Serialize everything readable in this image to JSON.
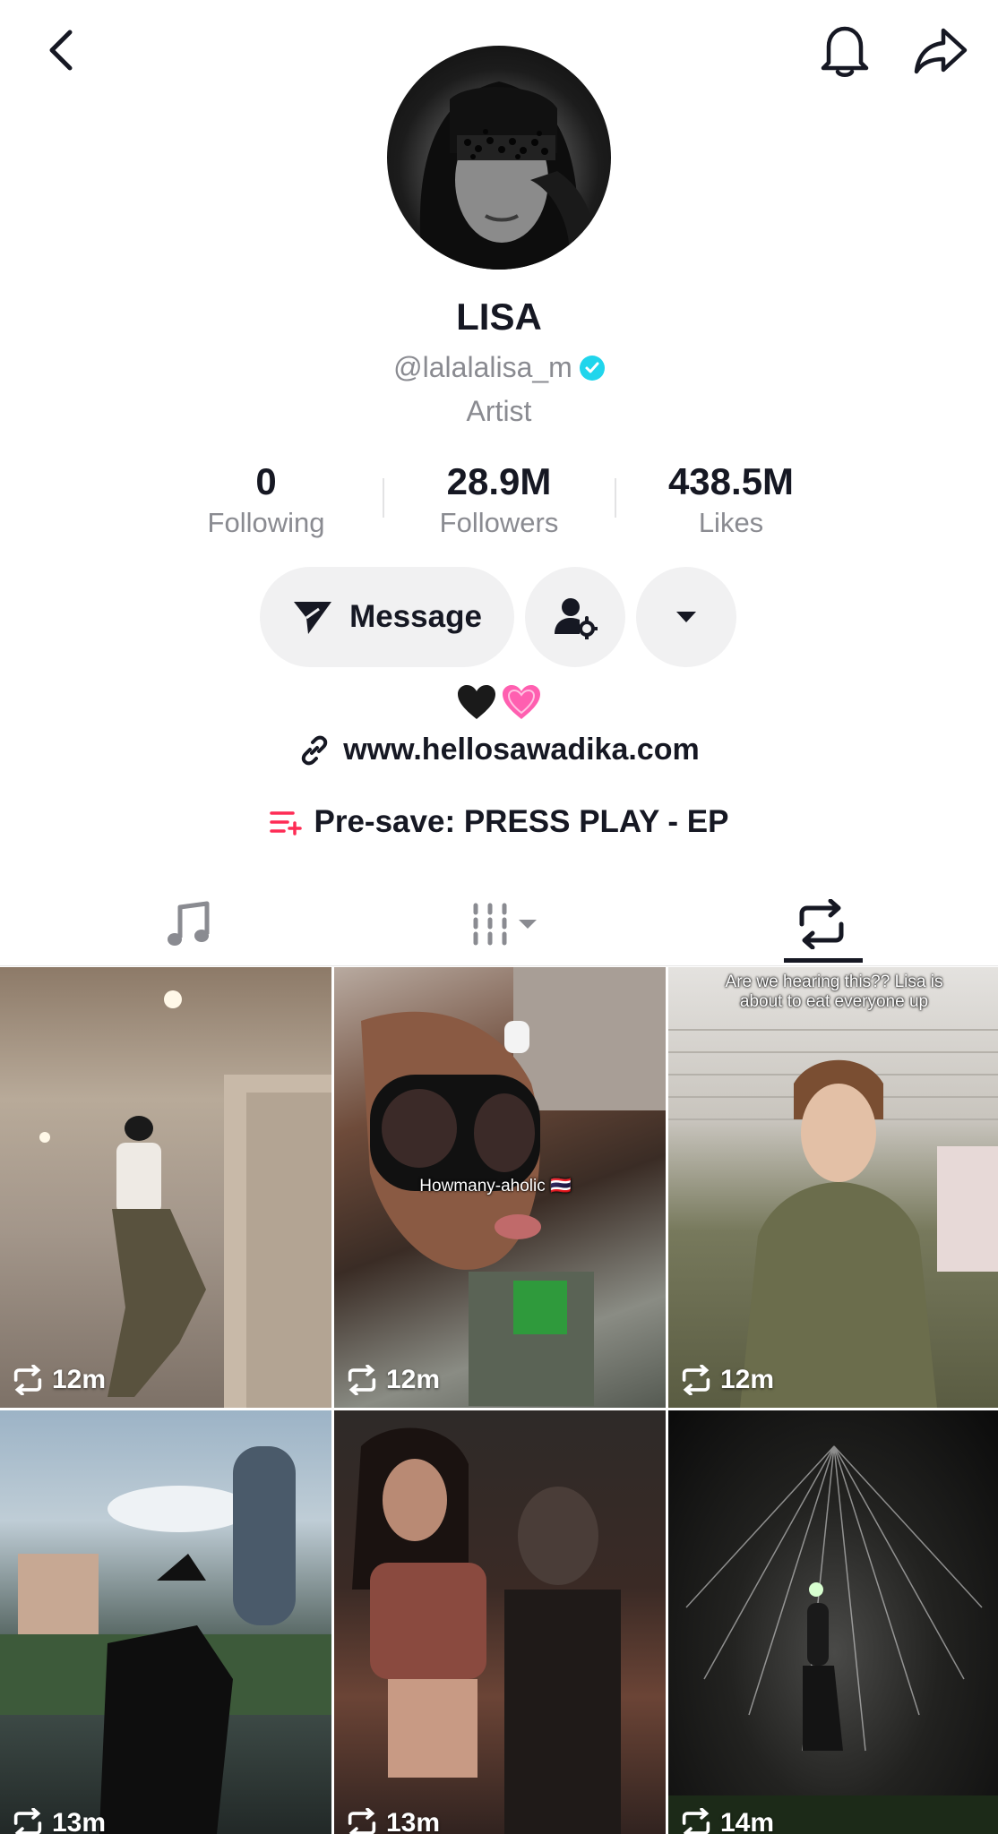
{
  "profile": {
    "name": "LISA",
    "handle": "@lalalalisa_m",
    "category": "Artist",
    "bio_emoji": "🖤💗",
    "link": "www.hellosawadika.com",
    "presave": "Pre-save: PRESS PLAY - EP"
  },
  "stats": {
    "following": {
      "value": "0",
      "label": "Following"
    },
    "followers": {
      "value": "28.9M",
      "label": "Followers"
    },
    "likes": {
      "value": "438.5M",
      "label": "Likes"
    }
  },
  "actions": {
    "message_label": "Message"
  },
  "icons": {
    "back": "chevron-left-icon",
    "notifications": "bell-icon",
    "share": "share-arrow-icon",
    "friend_settings": "user-settings-icon",
    "more": "caret-down-icon",
    "link": "link-icon",
    "playlist": "playlist-add-icon",
    "music_tab": "music-note-icon",
    "videos_tab": "grid-columns-icon",
    "reposts_tab": "repost-icon"
  },
  "colors": {
    "verified": "#20d5ec",
    "accent": "#fe2c55",
    "text": "#161823",
    "secondary": "#8a8b91"
  },
  "active_tab": "reposts",
  "videos": [
    {
      "views": "12m",
      "caption": ""
    },
    {
      "views": "12m",
      "caption": "Howmany-aholic 🇹🇭"
    },
    {
      "views": "12m",
      "caption": "Are we hearing this?? Lisa is about to eat everyone up"
    },
    {
      "views": "13m",
      "caption": ""
    },
    {
      "views": "13m",
      "caption": ""
    },
    {
      "views": "14m",
      "caption": ""
    }
  ]
}
